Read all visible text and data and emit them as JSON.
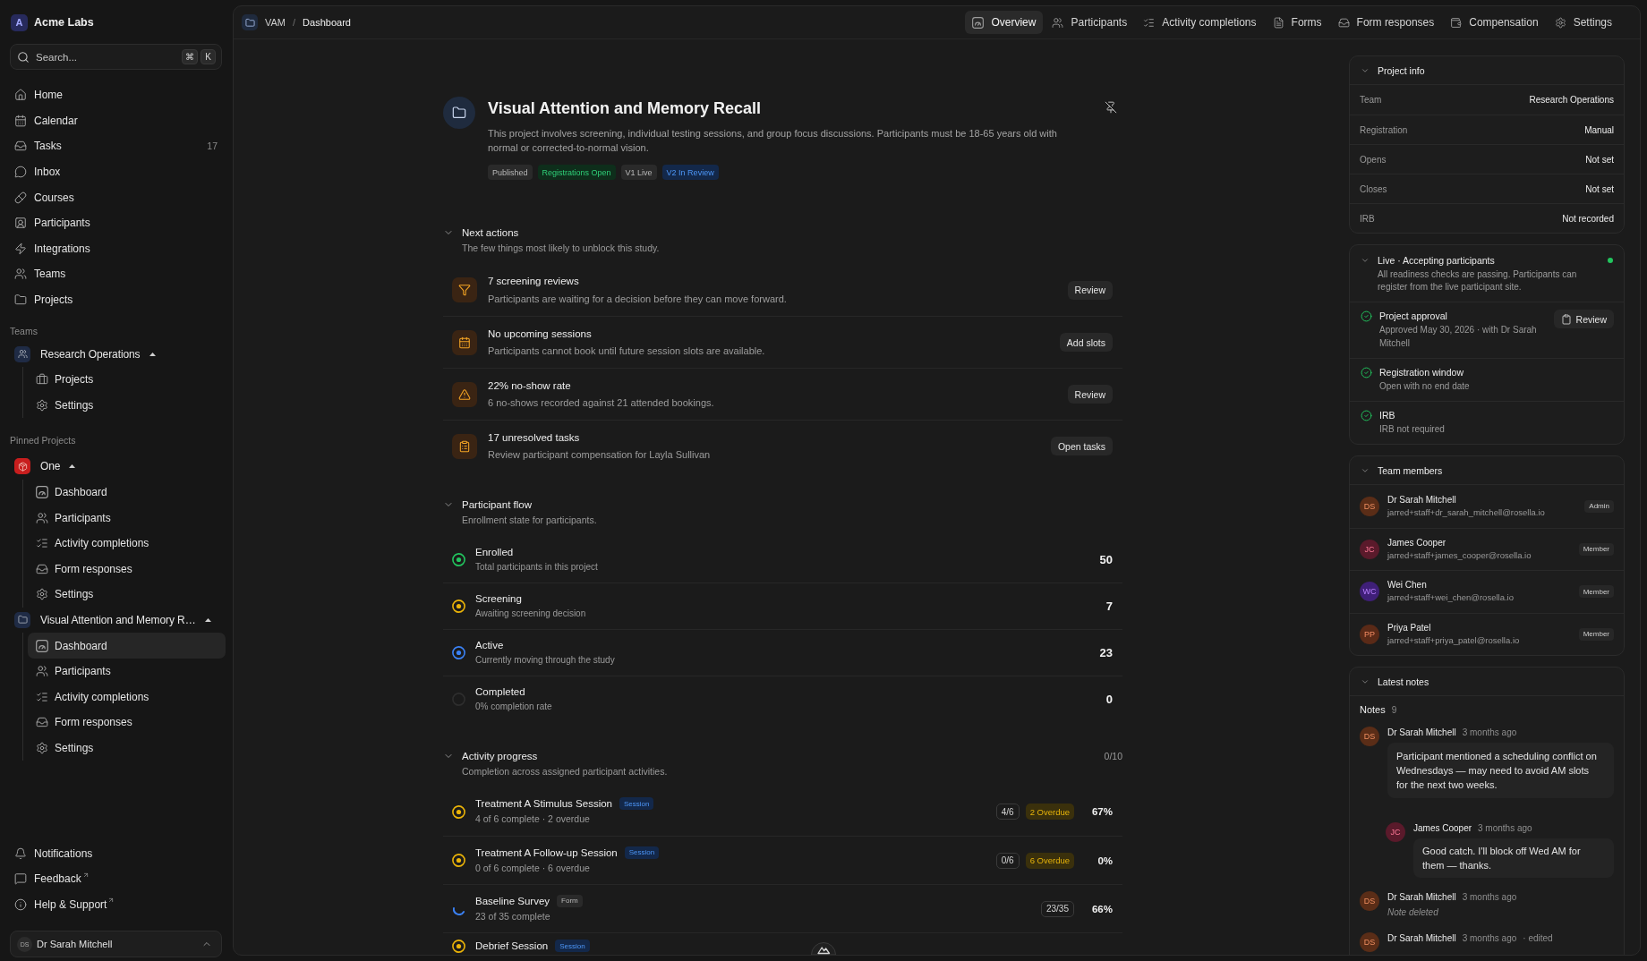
{
  "workspace": {
    "initial": "A",
    "name": "Acme Labs"
  },
  "search": {
    "placeholder": "Search...",
    "keys": [
      "⌘",
      "K"
    ]
  },
  "sidebar": {
    "nav": [
      {
        "label": "Home",
        "selected": false
      },
      {
        "label": "Calendar",
        "selected": false
      },
      {
        "label": "Tasks",
        "count": "17",
        "selected": false
      },
      {
        "label": "Inbox",
        "selected": false
      },
      {
        "label": "Courses",
        "selected": false
      },
      {
        "label": "Participants",
        "selected": false
      },
      {
        "label": "Integrations",
        "selected": false
      },
      {
        "label": "Teams",
        "selected": false
      },
      {
        "label": "Projects",
        "selected": false
      }
    ],
    "teams_label": "Teams",
    "teams": [
      {
        "name": "Research Operations",
        "color": "#1f2b45",
        "expanded": true,
        "children": [
          {
            "label": "Projects",
            "selected": false
          },
          {
            "label": "Settings",
            "selected": false
          }
        ]
      }
    ],
    "pinned_label": "Pinned Projects",
    "pinned_projects": [
      {
        "name": "One",
        "color": "#c81e1e",
        "expanded": true,
        "children": [
          {
            "label": "Dashboard",
            "selected": false
          },
          {
            "label": "Participants",
            "selected": false
          },
          {
            "label": "Activity completions",
            "selected": false
          },
          {
            "label": "Form responses",
            "selected": false
          },
          {
            "label": "Settings",
            "selected": false
          }
        ]
      },
      {
        "name": "Visual Attention and Memory R…",
        "color": "#1f2b45",
        "expanded": true,
        "children": [
          {
            "label": "Dashboard",
            "selected": true
          },
          {
            "label": "Participants",
            "selected": false
          },
          {
            "label": "Activity completions",
            "selected": false
          },
          {
            "label": "Form responses",
            "selected": false
          },
          {
            "label": "Settings",
            "selected": false
          }
        ]
      }
    ],
    "footer_links": [
      {
        "label": "Notifications",
        "external": false
      },
      {
        "label": "Feedback",
        "external": true
      },
      {
        "label": "Help & Support",
        "external": true
      }
    ],
    "user": {
      "initials": "DS",
      "name": "Dr Sarah Mitchell"
    }
  },
  "breadcrumb": {
    "items": [
      "VAM",
      "Dashboard"
    ],
    "separator": "/"
  },
  "tabs": [
    {
      "label": "Overview",
      "selected": true
    },
    {
      "label": "Participants",
      "selected": false
    },
    {
      "label": "Activity completions",
      "selected": false
    },
    {
      "label": "Forms",
      "selected": false
    },
    {
      "label": "Form responses",
      "selected": false
    },
    {
      "label": "Compensation",
      "selected": false
    },
    {
      "label": "Settings",
      "selected": false
    }
  ],
  "project": {
    "title": "Visual Attention and Memory Recall",
    "description": "This project involves screening, individual testing sessions, and group focus discussions. Participants must be 18-65 years old with normal or corrected-to-normal vision.",
    "tags": [
      {
        "label": "Published",
        "kind": "neutral"
      },
      {
        "label": "Registrations Open",
        "kind": "success"
      },
      {
        "label": "V1 Live",
        "kind": "neutral"
      },
      {
        "label": "V2 In Review",
        "kind": "info"
      }
    ]
  },
  "next_actions": {
    "title": "Next actions",
    "subtitle": "The few things most likely to unblock this study.",
    "expanded": true,
    "items": [
      {
        "title": "7 screening reviews",
        "description": "Participants are waiting for a decision before they can move forward.",
        "action": "Review"
      },
      {
        "title": "No upcoming sessions",
        "description": "Participants cannot book until future session slots are available.",
        "action": "Add slots"
      },
      {
        "title": "22% no-show rate",
        "description": "6 no-shows recorded against 21 attended bookings.",
        "action": "Review"
      },
      {
        "title": "17 unresolved tasks",
        "description": "Review participant compensation for Layla Sullivan",
        "action": "Open tasks"
      }
    ]
  },
  "participant_flow": {
    "title": "Participant flow",
    "subtitle": "Enrollment state for participants.",
    "expanded": true,
    "items": [
      {
        "label": "Enrolled",
        "description": "Total participants in this project",
        "value": "50",
        "kind": "ring",
        "color": "#22c55e"
      },
      {
        "label": "Screening",
        "description": "Awaiting screening decision",
        "value": "7",
        "kind": "ring",
        "color": "#eab308"
      },
      {
        "label": "Active",
        "description": "Currently moving through the study",
        "value": "23",
        "kind": "ring",
        "color": "#3b82f6"
      },
      {
        "label": "Completed",
        "description": "0% completion rate",
        "value": "0",
        "kind": "empty",
        "color": "#2e2e2e"
      }
    ]
  },
  "activity_progress": {
    "title": "Activity progress",
    "subtitle": "Completion across assigned participant activities.",
    "count": "0/10",
    "expanded": true,
    "items": [
      {
        "name": "Treatment A Stimulus Session",
        "tag": {
          "label": "Session",
          "kind": "info"
        },
        "summary": "4 of 6 complete · 2 overdue",
        "progress": "4/6",
        "overdue": "2 Overdue",
        "percent": "67%",
        "kind": "ring",
        "color": "#eab308"
      },
      {
        "name": "Treatment A Follow-up Session",
        "tag": {
          "label": "Session",
          "kind": "info"
        },
        "summary": "0 of 6 complete · 6 overdue",
        "progress": "0/6",
        "overdue": "6 Overdue",
        "percent": "0%",
        "kind": "ring",
        "color": "#eab308"
      },
      {
        "name": "Baseline Survey",
        "tag": {
          "label": "Form",
          "kind": "neutral"
        },
        "summary": "23 of 35 complete",
        "progress": "23/35",
        "percent": "66%",
        "kind": "arc",
        "color": "#3b82f6"
      },
      {
        "name": "Debrief Session",
        "tag": {
          "label": "Session",
          "kind": "info"
        },
        "kind": "ring",
        "color": "#eab308"
      }
    ]
  },
  "project_info": {
    "title": "Project info",
    "expanded": true,
    "rows": [
      {
        "label": "Team",
        "value": "Research Operations"
      },
      {
        "label": "Registration",
        "value": "Manual"
      },
      {
        "label": "Opens",
        "value": "Not set"
      },
      {
        "label": "Closes",
        "value": "Not set"
      },
      {
        "label": "IRB",
        "value": "Not recorded"
      }
    ]
  },
  "readiness": {
    "title": "Live · Accepting participants",
    "description": "All readiness checks are passing. Participants can register from the live participant site.",
    "live": true,
    "expanded": true,
    "checks": [
      {
        "title": "Project approval",
        "detail": "Approved May 30, 2026 · with Dr Sarah Mitchell",
        "passed": true,
        "action": "Review"
      },
      {
        "title": "Registration window",
        "detail": "Open with no end date",
        "passed": true
      },
      {
        "title": "IRB",
        "detail": "IRB not required",
        "passed": true
      }
    ]
  },
  "team_members": {
    "title": "Team members",
    "expanded": true,
    "members": [
      {
        "initials": "DS",
        "name": "Dr Sarah Mitchell",
        "email": "jarred+staff+dr_sarah_mitchell@rosella.io",
        "role": "Admin",
        "color": "#5a2d17"
      },
      {
        "initials": "JC",
        "name": "James Cooper",
        "email": "jarred+staff+james_cooper@rosella.io",
        "role": "Member",
        "color": "#5a1a2b"
      },
      {
        "initials": "WC",
        "name": "Wei Chen",
        "email": "jarred+staff+wei_chen@rosella.io",
        "role": "Member",
        "color": "#3f1f78"
      },
      {
        "initials": "PP",
        "name": "Priya Patel",
        "email": "jarred+staff+priya_patel@rosella.io",
        "role": "Member",
        "color": "#5a2a17"
      }
    ]
  },
  "latest_notes": {
    "title": "Latest notes",
    "expanded": true,
    "heading": "Notes",
    "count": "9",
    "notes": [
      {
        "kind": "comment",
        "initials": "DS",
        "author": "Dr Sarah Mitchell",
        "time": "3 months ago",
        "color": "#5a2d17",
        "body": "Participant mentioned a scheduling conflict on Wednesdays — may need to avoid AM slots for the next two weeks.",
        "replies": [
          {
            "kind": "comment",
            "initials": "JC",
            "author": "James Cooper",
            "time": "3 months ago",
            "color": "#5a1a2b",
            "body": "Good catch. I'll block off Wed AM for them — thanks."
          }
        ]
      },
      {
        "kind": "deleted",
        "initials": "DS",
        "author": "Dr Sarah Mitchell",
        "time": "3 months ago",
        "color": "#5a2d17",
        "body": "Note deleted"
      },
      {
        "kind": "comment",
        "initials": "DS",
        "author": "Dr Sarah Mitchell",
        "time": "3 months ago",
        "color": "#5a2d17",
        "edit_mark": "· edited"
      }
    ]
  }
}
